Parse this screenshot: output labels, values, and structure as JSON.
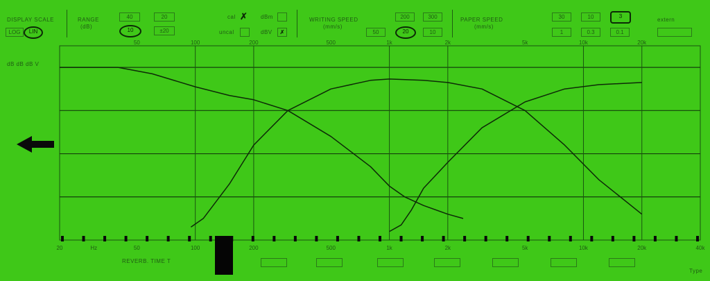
{
  "header": {
    "display_scale": {
      "label": "DISPLAY SCALE",
      "options": [
        "LOG",
        "LIN"
      ]
    },
    "range": {
      "label": "RANGE",
      "unit": "(dB)",
      "options": [
        "40",
        "20",
        "10",
        "±20"
      ],
      "selected": "10"
    },
    "reference": {
      "options": [
        "cal",
        "dBm",
        "uncal",
        "dBV"
      ],
      "checked": [
        "cal",
        "dBV"
      ]
    },
    "writing_speed": {
      "label": "WRITING SPEED",
      "unit": "(mm/s)",
      "options": [
        "200",
        "300",
        "50",
        "20",
        "10"
      ],
      "selected": "20"
    },
    "paper_speed": {
      "label": "PAPER SPEED",
      "unit": "(mm/s)",
      "options": [
        "30",
        "10",
        "3",
        "1",
        "0.3",
        "0.1"
      ],
      "selected": "3"
    },
    "extern": {
      "label": "extern"
    }
  },
  "left_scale": {
    "unit_label": "dB dB dB V"
  },
  "footer": {
    "reverb_label": "REVERB. TIME T",
    "type_label": "Type"
  },
  "arrow_icon": "left-arrow-icon",
  "chart_data": {
    "type": "line",
    "x_scale": "log",
    "xlim": [
      20,
      40000
    ],
    "top_ticks": [
      "50",
      "100",
      "200",
      "500",
      "1k",
      "2k",
      "5k",
      "10k",
      "20k"
    ],
    "bottom_ticks": [
      "20",
      "Hz",
      "50",
      "100",
      "200",
      "500",
      "1k",
      "2k",
      "5k",
      "10k",
      "20k",
      "40k"
    ],
    "ylim": [
      -40,
      5
    ],
    "grid": true,
    "series": [
      {
        "x": [
          20,
          40,
          60,
          100,
          150,
          200,
          300,
          500,
          800,
          1000,
          1200,
          1500,
          2000,
          2400
        ],
        "values": [
          0,
          0,
          -1.5,
          -4.5,
          -6.5,
          -7.5,
          -10,
          -16,
          -23,
          -27.5,
          -30,
          -32,
          -34,
          -35
        ]
      },
      {
        "x": [
          95,
          110,
          150,
          200,
          300,
          500,
          800,
          1000,
          1500,
          2000,
          3000,
          5000
        ],
        "values": [
          -37,
          -35,
          -27,
          -18,
          -10,
          -5,
          -3,
          -2.7,
          -3,
          -3.5,
          -5,
          -10
        ]
      },
      {
        "x": [
          1000,
          1150,
          1300,
          1500,
          2000,
          3000,
          5000,
          8000,
          12000,
          20000
        ],
        "values": [
          -38,
          -36.5,
          -33,
          -28,
          -22,
          -14,
          -8,
          -5,
          -4,
          -3.5
        ]
      },
      {
        "x": [
          5000,
          8000,
          12000,
          20000
        ],
        "values": [
          -10,
          -18,
          -26,
          -34
        ]
      }
    ]
  }
}
